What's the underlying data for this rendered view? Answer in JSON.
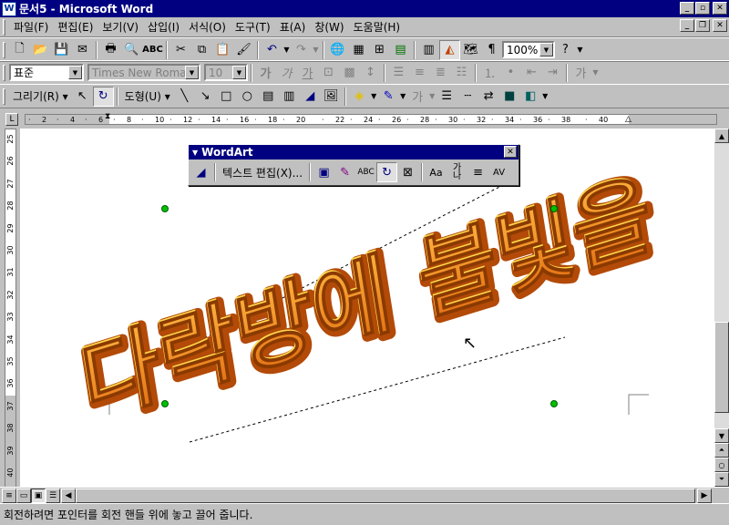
{
  "window": {
    "title": "문서5 - Microsoft Word",
    "app_icon": "W",
    "min": "_",
    "max": "▫",
    "close": "✕"
  },
  "menu": {
    "items": [
      "파일(F)",
      "편집(E)",
      "보기(V)",
      "삽입(I)",
      "서식(O)",
      "도구(T)",
      "표(A)",
      "창(W)",
      "도움말(H)"
    ]
  },
  "standard_toolbar": {
    "zoom": "100%"
  },
  "formatting_toolbar": {
    "style": "표준",
    "font": "Times New Roman",
    "size": "10"
  },
  "drawing_toolbar": {
    "draw_label": "그리기(R) ▾",
    "autoshapes_label": "도형(U) ▾"
  },
  "ruler": {
    "numbers": [
      "2",
      "4",
      "6",
      "8",
      "10",
      "12",
      "14",
      "16",
      "18",
      "20",
      "22",
      "24",
      "26",
      "28",
      "30",
      "32",
      "34",
      "36",
      "38",
      "40"
    ],
    "vnumbers": [
      "25",
      "26",
      "27",
      "28",
      "29",
      "30",
      "31",
      "32",
      "33",
      "34",
      "35",
      "36",
      "37",
      "38",
      "39",
      "40"
    ]
  },
  "wordart": {
    "title": "WordArt",
    "text": "다락방에 불빛을",
    "edit_text": "텍스트 편집(X)...",
    "colors": {
      "front": "#f28c1a",
      "side": "#b34a08",
      "top": "#ffd94d"
    }
  },
  "status": {
    "text": "회전하려면 포인터를 회전 핸들 위에 놓고 끌어 줍니다."
  }
}
